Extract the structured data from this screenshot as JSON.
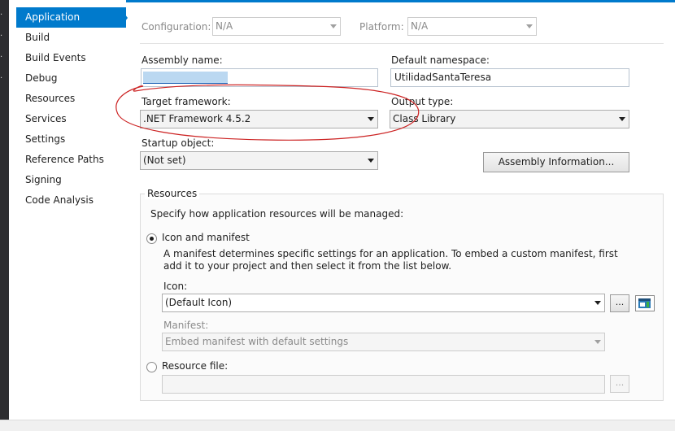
{
  "nav": {
    "items": [
      {
        "label": "Application",
        "active": true
      },
      {
        "label": "Build"
      },
      {
        "label": "Build Events"
      },
      {
        "label": "Debug"
      },
      {
        "label": "Resources"
      },
      {
        "label": "Services"
      },
      {
        "label": "Settings"
      },
      {
        "label": "Reference Paths"
      },
      {
        "label": "Signing"
      },
      {
        "label": "Code Analysis"
      }
    ]
  },
  "config": {
    "configuration_label": "Configuration:",
    "configuration_value": "N/A",
    "platform_label": "Platform:",
    "platform_value": "N/A"
  },
  "application": {
    "assembly_name_label": "Assembly name:",
    "assembly_name_value": "",
    "default_namespace_label": "Default namespace:",
    "default_namespace_value": "UtilidadSantaTeresa",
    "target_framework_label": "Target framework:",
    "target_framework_value": ".NET Framework 4.5.2",
    "output_type_label": "Output type:",
    "output_type_value": "Class Library",
    "startup_object_label": "Startup object:",
    "startup_object_value": "(Not set)",
    "assembly_info_button": "Assembly Information..."
  },
  "resources": {
    "group_title": "Resources",
    "intro": "Specify how application resources will be managed:",
    "icon_manifest_label": "Icon and manifest",
    "icon_manifest_desc": "A manifest determines specific settings for an application. To embed a custom manifest, first add it to your project and then select it from the list below.",
    "icon_label": "Icon:",
    "icon_value": "(Default Icon)",
    "browse_label": "...",
    "manifest_label": "Manifest:",
    "manifest_value": "Embed manifest with default settings",
    "resource_file_label": "Resource file:",
    "resource_file_value": "",
    "resource_browse_label": "..."
  },
  "colors": {
    "accent": "#007acc",
    "annotation": "#cc2222"
  }
}
